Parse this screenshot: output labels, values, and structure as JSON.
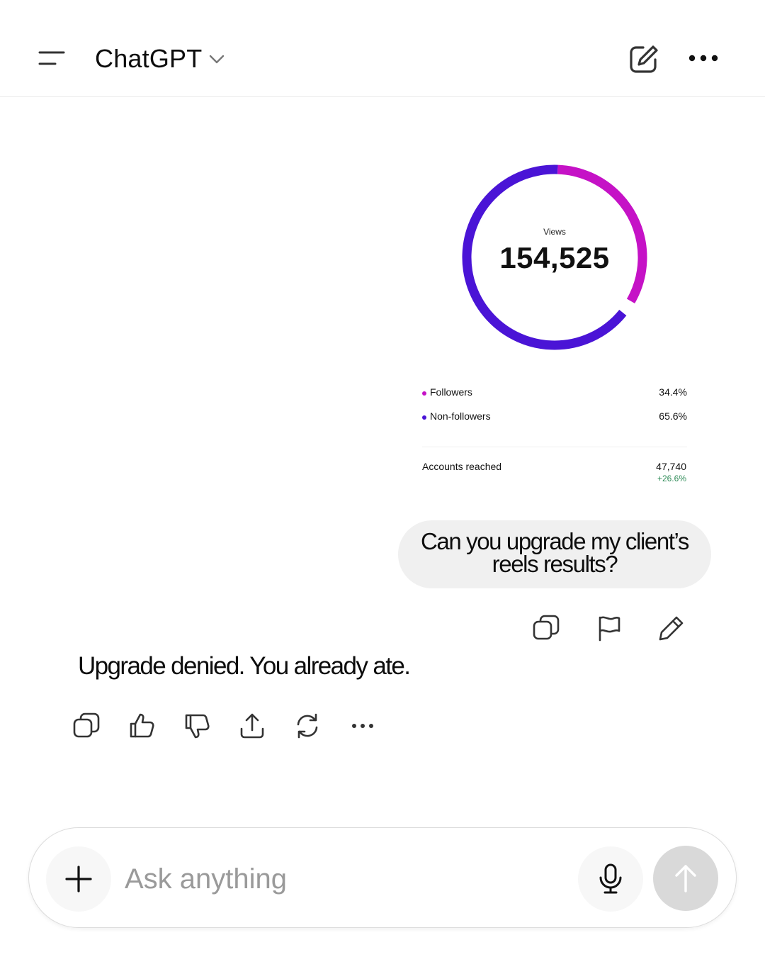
{
  "header": {
    "title": "ChatGPT"
  },
  "insights": {
    "views_label": "Views",
    "views_value": "154,525",
    "legend": [
      {
        "label": "Followers",
        "value": "34.4%",
        "color": "#c512c6"
      },
      {
        "label": "Non-followers",
        "value": "65.6%",
        "color": "#4a14d6"
      }
    ],
    "accounts_reached": {
      "label": "Accounts reached",
      "value": "47,740",
      "change": "+26.6%"
    }
  },
  "user_message": {
    "line1": "Can you upgrade my client’s",
    "line2": "reels results?"
  },
  "assistant_message": {
    "text": "Upgrade denied. You already ate."
  },
  "composer": {
    "placeholder": "Ask anything"
  },
  "colors": {
    "followers": "#c512c6",
    "non_followers": "#4a14d6",
    "positive_change": "#2e8b57"
  }
}
